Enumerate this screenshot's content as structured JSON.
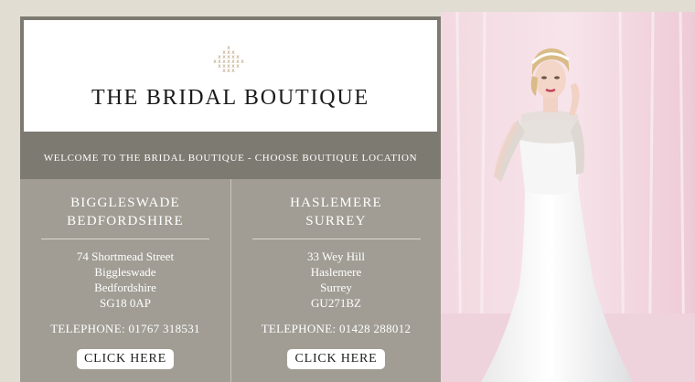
{
  "brand": {
    "title": "THE BRIDAL BOUTIQUE",
    "logo_icon": "cross-stitch-diamond-icon"
  },
  "welcome": {
    "text": "WELCOME TO THE BRIDAL BOUTIQUE - CHOOSE BOUTIQUE LOCATION"
  },
  "locations": [
    {
      "name_line1": "BIGGLESWADE",
      "name_line2": "BEDFORDSHIRE",
      "address": [
        "74 Shortmead Street",
        "Biggleswade",
        "Bedfordshire",
        "SG18 0AP"
      ],
      "telephone": "TELEPHONE: 01767 318531",
      "button_label": "CLICK HERE"
    },
    {
      "name_line1": "HASLEMERE",
      "name_line2": "SURREY",
      "address": [
        "33 Wey Hill",
        "Haslemere",
        "Surrey",
        "GU271BZ"
      ],
      "telephone": "TELEPHONE: 01428 288012",
      "button_label": "CLICK HERE"
    }
  ],
  "colors": {
    "page_background": "#e1ddd3",
    "panel_grey": "#a19d94",
    "dark_grey": "#7d7a72",
    "logo_accent": "#b59a76",
    "photo_background": "#f1d3dc"
  }
}
